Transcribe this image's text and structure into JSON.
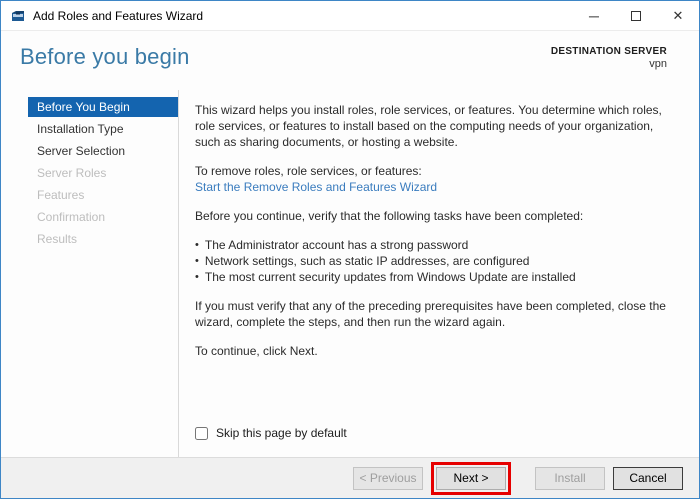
{
  "window": {
    "title": "Add Roles and Features Wizard",
    "minimize_glyph": "─",
    "close_glyph": "✕"
  },
  "header": {
    "page_title": "Before you begin",
    "destination_label": "DESTINATION SERVER",
    "server_name": "vpn"
  },
  "sidebar": {
    "items": [
      {
        "label": "Before You Begin",
        "state": "selected"
      },
      {
        "label": "Installation Type",
        "state": "enabled"
      },
      {
        "label": "Server Selection",
        "state": "enabled"
      },
      {
        "label": "Server Roles",
        "state": "disabled"
      },
      {
        "label": "Features",
        "state": "disabled"
      },
      {
        "label": "Confirmation",
        "state": "disabled"
      },
      {
        "label": "Results",
        "state": "disabled"
      }
    ]
  },
  "content": {
    "intro": "This wizard helps you install roles, role services, or features. You determine which roles, role services, or features to install based on the computing needs of your organization, such as sharing documents, or hosting a website.",
    "remove_heading": "To remove roles, role services, or features:",
    "remove_link": "Start the Remove Roles and Features Wizard",
    "verify_heading": "Before you continue, verify that the following tasks have been completed:",
    "bullet_glyph": "•",
    "bullets": [
      "The Administrator account has a strong password",
      "Network settings, such as static IP addresses, are configured",
      "The most current security updates from Windows Update are installed"
    ],
    "note": "If you must verify that any of the preceding prerequisites have been completed, close the wizard, complete the steps, and then run the wizard again.",
    "continue_text": "To continue, click Next.",
    "skip_checkbox_label": "Skip this page by default",
    "skip_checkbox_checked": false
  },
  "footer": {
    "previous_label": "< Previous",
    "next_label": "Next >",
    "install_label": "Install",
    "cancel_label": "Cancel"
  },
  "colors": {
    "accent_selected_nav": "#1464af",
    "window_border": "#3e86c6",
    "page_title_blue": "#3a7aa6",
    "link_blue": "#3a7cbe",
    "annotation_red": "#e60000",
    "footer_gray": "#f0f0f0"
  }
}
